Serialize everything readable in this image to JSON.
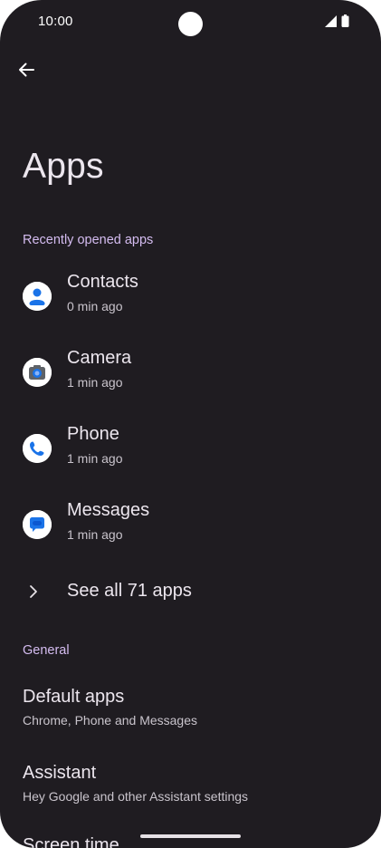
{
  "status_bar": {
    "time": "10:00"
  },
  "header": {
    "title": "Apps"
  },
  "recent": {
    "section_label": "Recently opened apps",
    "items": [
      {
        "name": "Contacts",
        "time": "0 min ago",
        "icon": "contacts-icon"
      },
      {
        "name": "Camera",
        "time": "1 min ago",
        "icon": "camera-icon"
      },
      {
        "name": "Phone",
        "time": "1 min ago",
        "icon": "phone-icon"
      },
      {
        "name": "Messages",
        "time": "1 min ago",
        "icon": "messages-icon"
      }
    ],
    "see_all_label": "See all 71 apps"
  },
  "general": {
    "section_label": "General",
    "items": [
      {
        "title": "Default apps",
        "subtitle": "Chrome, Phone and Messages"
      },
      {
        "title": "Assistant",
        "subtitle": "Hey Google and other Assistant settings"
      }
    ],
    "partial_item_title": "Screen time"
  },
  "colors": {
    "background": "#1f1c21",
    "accent_section": "#d4bcf0",
    "icon_blue": "#1a73e8"
  }
}
